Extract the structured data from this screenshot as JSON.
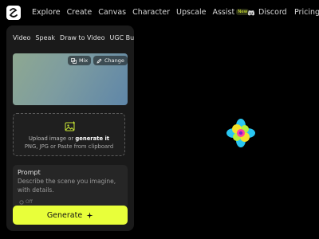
{
  "nav": {
    "items": [
      {
        "label": "Explore"
      },
      {
        "label": "Create"
      },
      {
        "label": "Canvas"
      },
      {
        "label": "Character"
      },
      {
        "label": "Upscale"
      },
      {
        "label": "Assist",
        "badge": "New"
      }
    ],
    "discord_label": "Discord",
    "pricing_label": "Pricing"
  },
  "panel": {
    "tabs": [
      "Video",
      "Speak",
      "Draw to Video",
      "UGC Builder"
    ],
    "preview": {
      "mix_label": "Mix",
      "change_label": "Change"
    },
    "upload": {
      "prefix": "Upload image or ",
      "link": "generate it",
      "hint": "PNG, JPG or Paste from clipboard"
    },
    "prompt": {
      "label": "Prompt",
      "placeholder": "Describe the scene you imagine, with details.",
      "toggle_label": "Off"
    },
    "generate_label": "Generate"
  },
  "colors": {
    "accent": "#e8ff3a",
    "background": "#000000",
    "panel": "#1a1a1a"
  }
}
